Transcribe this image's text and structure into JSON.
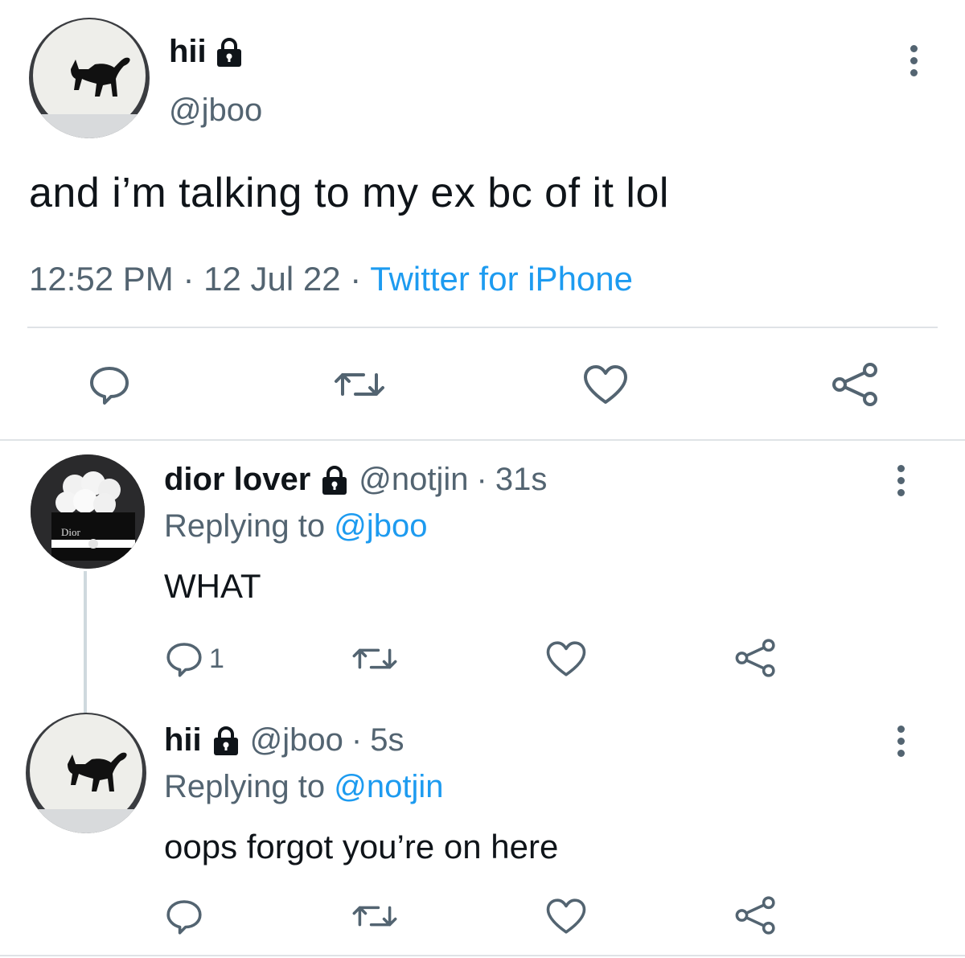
{
  "main_tweet": {
    "display_name": "hii",
    "handle": "@jboo",
    "text": "and i’m talking to my ex bc of it lol",
    "time": "12:52 PM",
    "date": "12 Jul 22",
    "source": "Twitter for iPhone",
    "separator": "·"
  },
  "reply1": {
    "display_name": "dior lover",
    "handle": "@notjin",
    "time": "31s",
    "separator": "·",
    "replying_prefix": "Replying to",
    "replying_to": "@jboo",
    "text": "WHAT",
    "reply_count": "1",
    "avatar_logo_text": "Dior"
  },
  "reply2": {
    "display_name": "hii",
    "handle": "@jboo",
    "time": "5s",
    "separator": "·",
    "replying_prefix": "Replying to",
    "replying_to": "@notjin",
    "text": "oops forgot you’re on here"
  },
  "colors": {
    "text": "#0f1419",
    "muted": "#536471",
    "link": "#1d9bf0",
    "divider": "#dfe3e6"
  },
  "icons": [
    "lock-icon",
    "more-options-icon",
    "reply-icon",
    "retweet-icon",
    "like-icon",
    "share-icon"
  ]
}
